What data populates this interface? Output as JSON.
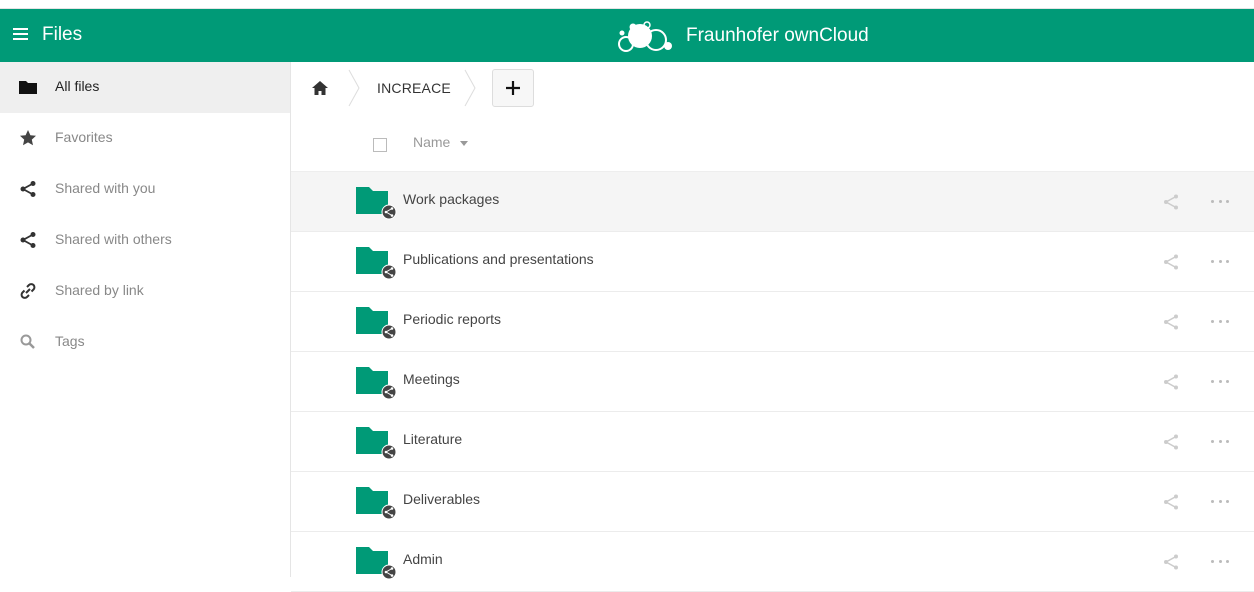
{
  "header": {
    "app_title": "Files",
    "brand_name": "Fraunhofer ownCloud",
    "color": "#009a77"
  },
  "sidebar": {
    "items": [
      {
        "label": "All files",
        "icon": "folder-icon",
        "active": true
      },
      {
        "label": "Favorites",
        "icon": "star-icon"
      },
      {
        "label": "Shared with you",
        "icon": "share-icon"
      },
      {
        "label": "Shared with others",
        "icon": "share-icon"
      },
      {
        "label": "Shared by link",
        "icon": "link-icon"
      },
      {
        "label": "Tags",
        "icon": "search-icon"
      }
    ]
  },
  "breadcrumb": {
    "home_icon": "home-icon",
    "current": "INCREACE",
    "add_icon": "plus-icon"
  },
  "table": {
    "name_header": "Name"
  },
  "files": [
    {
      "name": "Work packages"
    },
    {
      "name": "Publications and presentations"
    },
    {
      "name": "Periodic reports"
    },
    {
      "name": "Meetings"
    },
    {
      "name": "Literature"
    },
    {
      "name": "Deliverables"
    },
    {
      "name": "Admin"
    }
  ]
}
